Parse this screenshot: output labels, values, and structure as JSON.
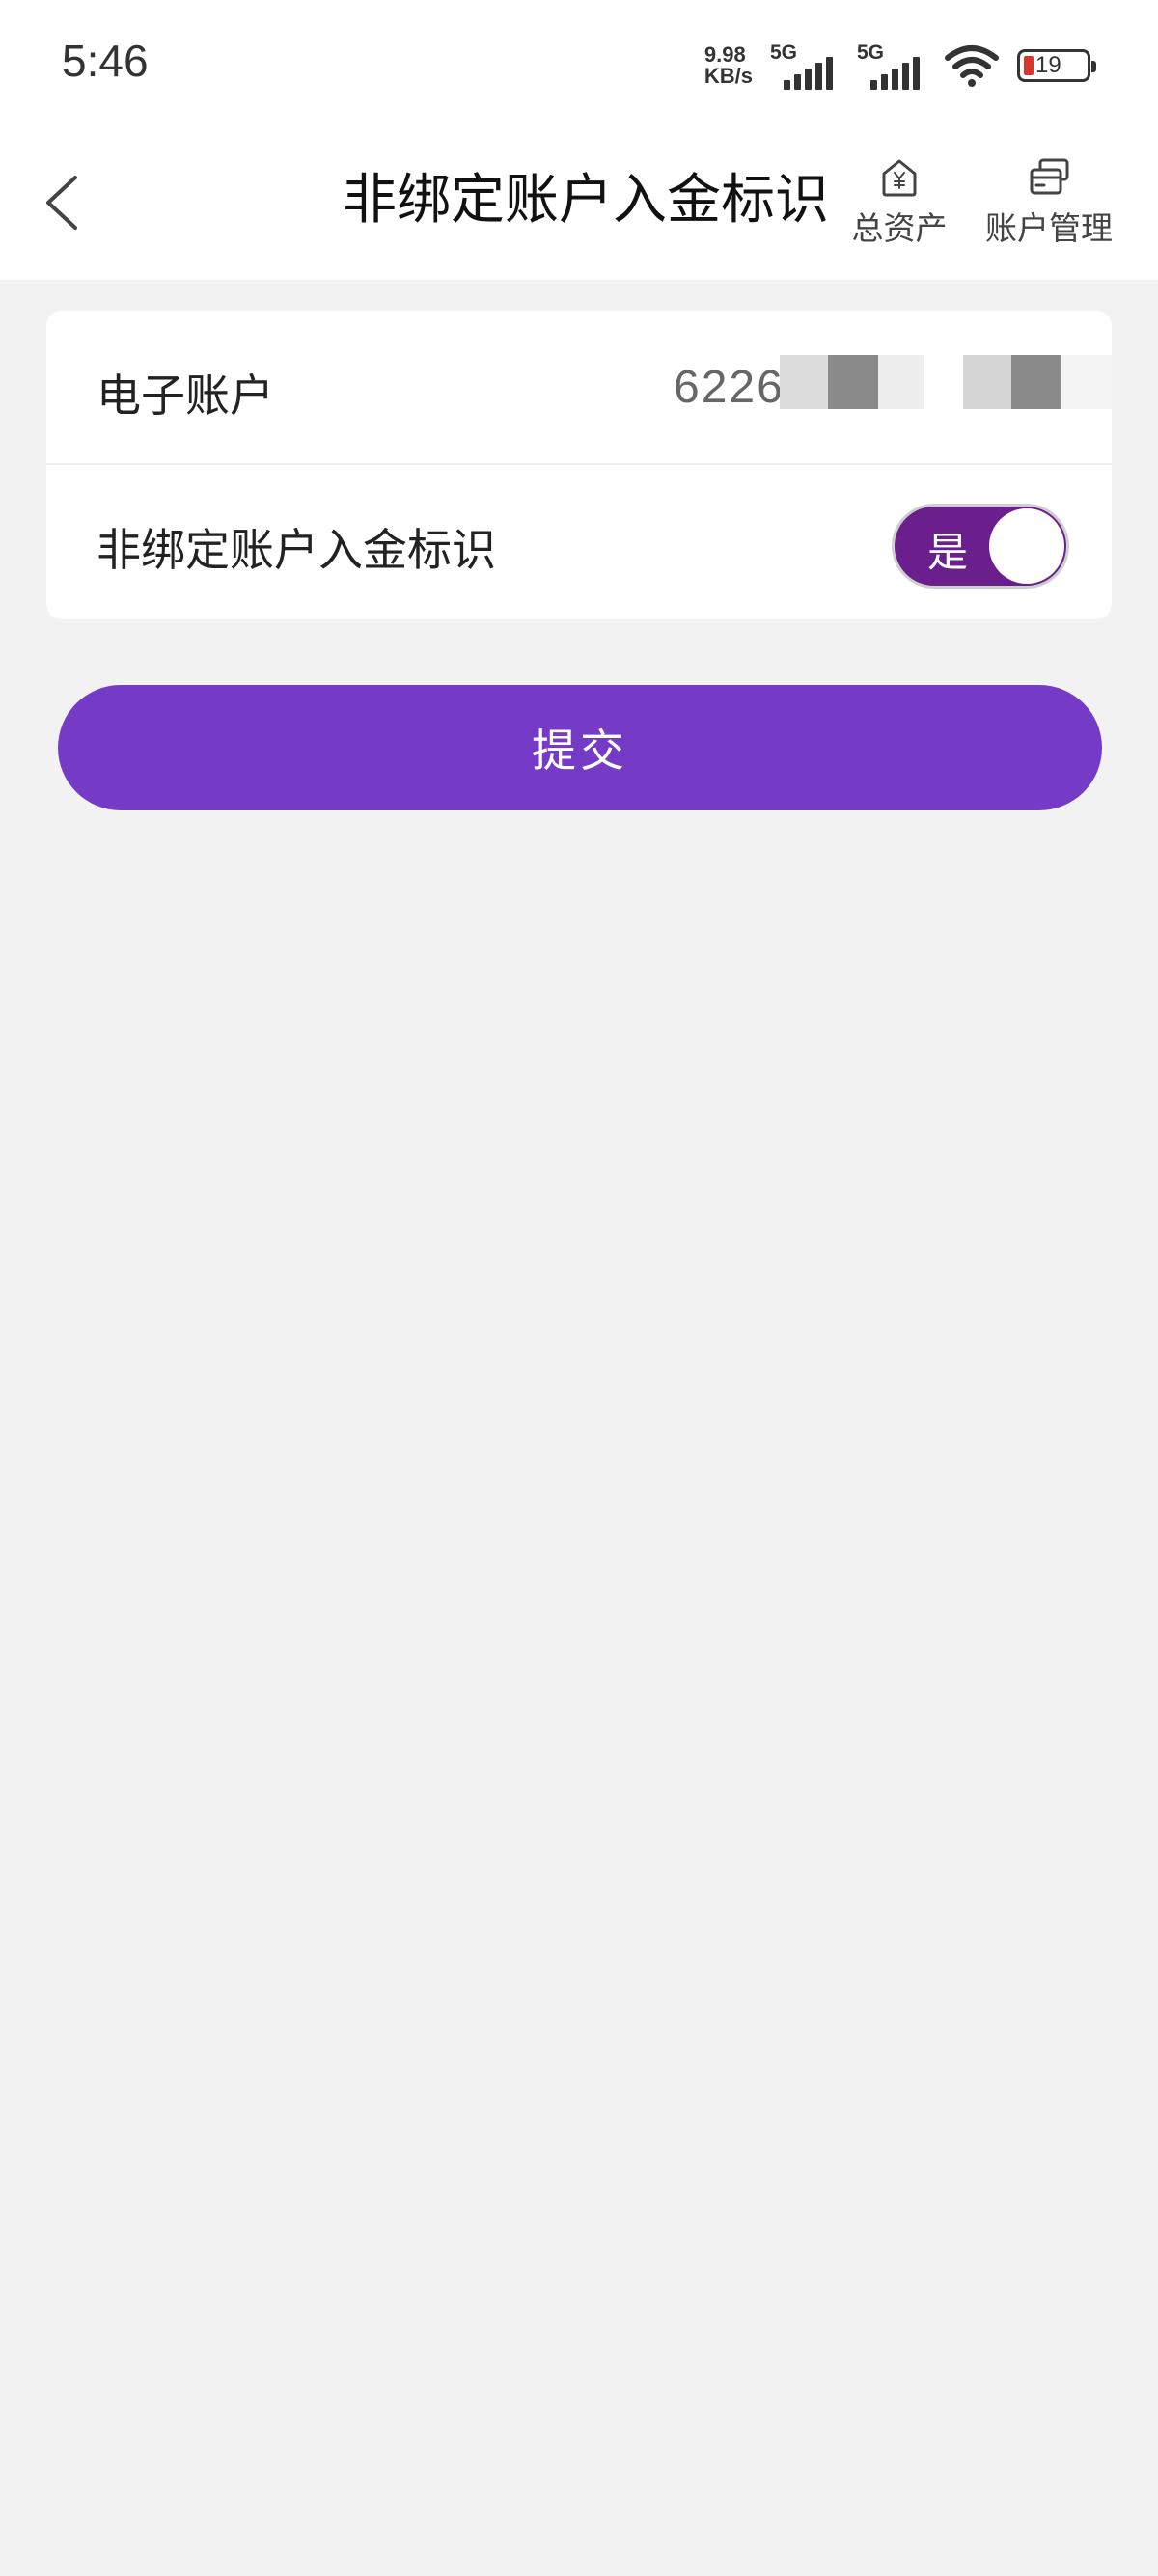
{
  "status_bar": {
    "time": "5:46",
    "net_speed_value": "9.98",
    "net_speed_unit": "KB/s",
    "sim1_tag": "5G",
    "sim2_tag": "5G",
    "battery_level": "19",
    "battery_color": "#d8382c"
  },
  "header": {
    "title": "非绑定账户入金标识",
    "back_icon": "chevron-left-icon",
    "actions": [
      {
        "label": "总资产",
        "icon": "house-yen-icon"
      },
      {
        "label": "账户管理",
        "icon": "card-stack-icon"
      }
    ]
  },
  "form": {
    "account_label": "电子账户",
    "account_number": "6226",
    "flag_label": "非绑定账户入金标识",
    "flag_toggle_label": "是",
    "flag_toggle_on": true
  },
  "submit_label": "提交",
  "colors": {
    "primary": "#763bc6",
    "toggle_on": "#6a1f8c",
    "background": "#f2f2f2"
  }
}
